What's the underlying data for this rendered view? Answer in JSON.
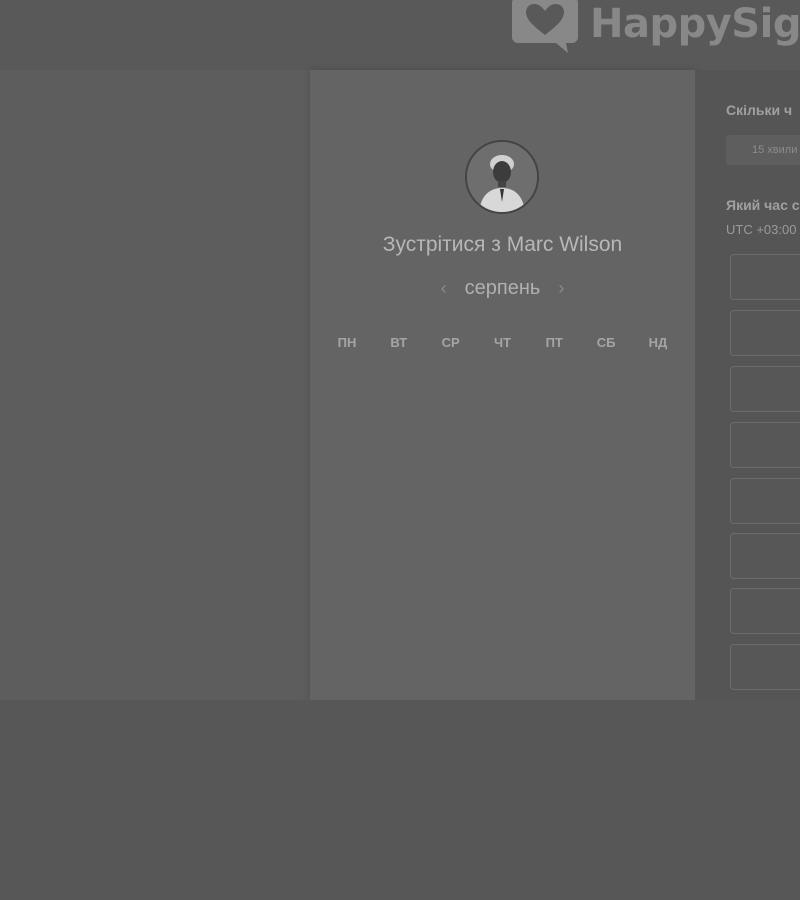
{
  "header": {
    "logo_text": "HappySig",
    "logo_icon": "heart-speech-bubble-icon"
  },
  "card": {
    "avatar_icon": "person-avatar",
    "title": "Зустрітися з Marc Wilson",
    "month": "серпень",
    "prev_icon": "chevron-left-icon",
    "next_icon": "chevron-right-icon",
    "prev_glyph": "‹",
    "next_glyph": "›",
    "weekdays": [
      "ПН",
      "ВТ",
      "СР",
      "ЧТ",
      "ПТ",
      "СБ",
      "НД"
    ]
  },
  "right_panel": {
    "duration_heading": "Скільки ч",
    "duration_value": "15 хвили",
    "time_heading": "Який час с",
    "timezone": "UTC +03:00",
    "slot_count": 8
  }
}
